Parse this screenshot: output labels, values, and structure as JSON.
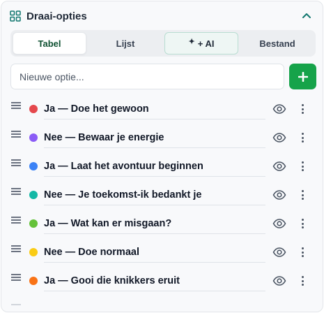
{
  "panel": {
    "title": "Draai-opties",
    "icons": {
      "title_icon": "grid-icon",
      "collapse": "chevron-up-icon"
    }
  },
  "tabs": [
    {
      "label": "Tabel",
      "active": true
    },
    {
      "label": "Lijst",
      "active": false
    },
    {
      "label": "+ AI",
      "active": false,
      "icon": "sparkle-icon"
    },
    {
      "label": "Bestand",
      "active": false
    }
  ],
  "add_option": {
    "placeholder": "Nieuwe optie...",
    "value": "",
    "button_icon": "plus-icon"
  },
  "options": [
    {
      "label": "Ja — Doe het gewoon",
      "color": "#e5484d"
    },
    {
      "label": "Nee — Bewaar je energie",
      "color": "#8b5cf6"
    },
    {
      "label": "Ja — Laat het avontuur beginnen",
      "color": "#3b82f6"
    },
    {
      "label": "Nee — Je toekomst-ik bedankt je",
      "color": "#14b8a6"
    },
    {
      "label": "Ja — Wat kan er misgaan?",
      "color": "#65c23a"
    },
    {
      "label": "Nee — Doe normaal",
      "color": "#facc15"
    },
    {
      "label": "Ja — Gooi die knikkers eruit",
      "color": "#f97316"
    }
  ],
  "colors": {
    "accent": "#16a34a",
    "tab_active_text": "#0f5132"
  }
}
